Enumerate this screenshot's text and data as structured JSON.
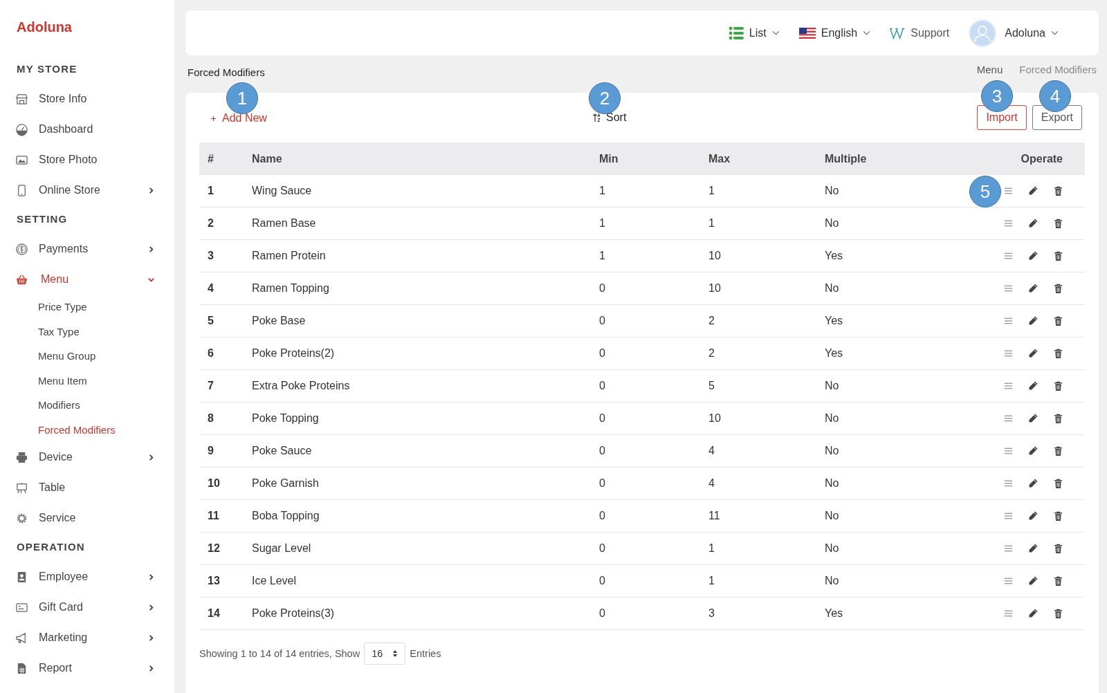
{
  "brand": "Adoluna",
  "sidebar": {
    "sections": [
      {
        "heading": "MY STORE",
        "items": [
          {
            "label": "Store Info",
            "selected": false
          },
          {
            "label": "Dashboard",
            "selected": false
          },
          {
            "label": "Store Photo",
            "selected": false
          },
          {
            "label": "Online Store",
            "selected": false,
            "expanded": false
          }
        ]
      },
      {
        "heading": "SETTING",
        "items": [
          {
            "label": "Payments",
            "selected": false,
            "expanded": false
          },
          {
            "label": "Menu",
            "selected": true,
            "expanded": true,
            "children": [
              {
                "label": "Price Type",
                "selected": false
              },
              {
                "label": "Tax Type",
                "selected": false
              },
              {
                "label": "Menu Group",
                "selected": false
              },
              {
                "label": "Menu Item",
                "selected": false
              },
              {
                "label": "Modifiers",
                "selected": false
              },
              {
                "label": "Forced Modifiers",
                "selected": true
              }
            ]
          },
          {
            "label": "Device",
            "selected": false,
            "expanded": false
          },
          {
            "label": "Table",
            "selected": false
          },
          {
            "label": "Service",
            "selected": false
          }
        ]
      },
      {
        "heading": "OPERATION",
        "items": [
          {
            "label": "Employee",
            "selected": false,
            "expanded": false
          },
          {
            "label": "Gift Card",
            "selected": false,
            "expanded": false
          },
          {
            "label": "Marketing",
            "selected": false,
            "expanded": false
          },
          {
            "label": "Report",
            "selected": false,
            "expanded": false
          }
        ]
      }
    ]
  },
  "topbar": {
    "view": "List",
    "language": "English",
    "support": "Support",
    "user": "Adoluna"
  },
  "page": {
    "title": "Forced Modifiers",
    "breadcrumb": [
      "Menu",
      "Forced Modifiers"
    ]
  },
  "toolbar": {
    "add": "Add New",
    "sort": "Sort",
    "buttons": [
      {
        "label": "Import",
        "kind": "primary"
      },
      {
        "label": "Export",
        "kind": "default"
      }
    ]
  },
  "table": {
    "columns": [
      "#",
      "Name",
      "Min",
      "Max",
      "Multiple",
      "Operate"
    ],
    "rows": [
      {
        "cells": [
          "1",
          "Wing Sauce",
          "1",
          "1",
          "No"
        ]
      },
      {
        "cells": [
          "2",
          "Ramen Base",
          "1",
          "1",
          "No"
        ]
      },
      {
        "cells": [
          "3",
          "Ramen Protein",
          "1",
          "10",
          "Yes"
        ]
      },
      {
        "cells": [
          "4",
          "Ramen Topping",
          "0",
          "10",
          "No"
        ]
      },
      {
        "cells": [
          "5",
          "Poke Base",
          "0",
          "2",
          "Yes"
        ]
      },
      {
        "cells": [
          "6",
          "Poke Proteins(2)",
          "0",
          "2",
          "Yes"
        ]
      },
      {
        "cells": [
          "7",
          "Extra Poke Proteins",
          "0",
          "5",
          "No"
        ]
      },
      {
        "cells": [
          "8",
          "Poke Topping",
          "0",
          "10",
          "No"
        ]
      },
      {
        "cells": [
          "9",
          "Poke Sauce",
          "0",
          "4",
          "No"
        ]
      },
      {
        "cells": [
          "10",
          "Poke Garnish",
          "0",
          "4",
          "No"
        ]
      },
      {
        "cells": [
          "11",
          "Boba Topping",
          "0",
          "11",
          "No"
        ]
      },
      {
        "cells": [
          "12",
          "Sugar Level",
          "0",
          "1",
          "No"
        ]
      },
      {
        "cells": [
          "13",
          "Ice Level",
          "0",
          "1",
          "No"
        ]
      },
      {
        "cells": [
          "14",
          "Poke Proteins(3)",
          "0",
          "3",
          "Yes"
        ]
      }
    ]
  },
  "footer": {
    "summary": "Showing 1 to 14 of 14 entries, Show",
    "page_size": "16",
    "suffix": "Entries"
  },
  "callouts": [
    "1",
    "2",
    "3",
    "4",
    "5"
  ]
}
